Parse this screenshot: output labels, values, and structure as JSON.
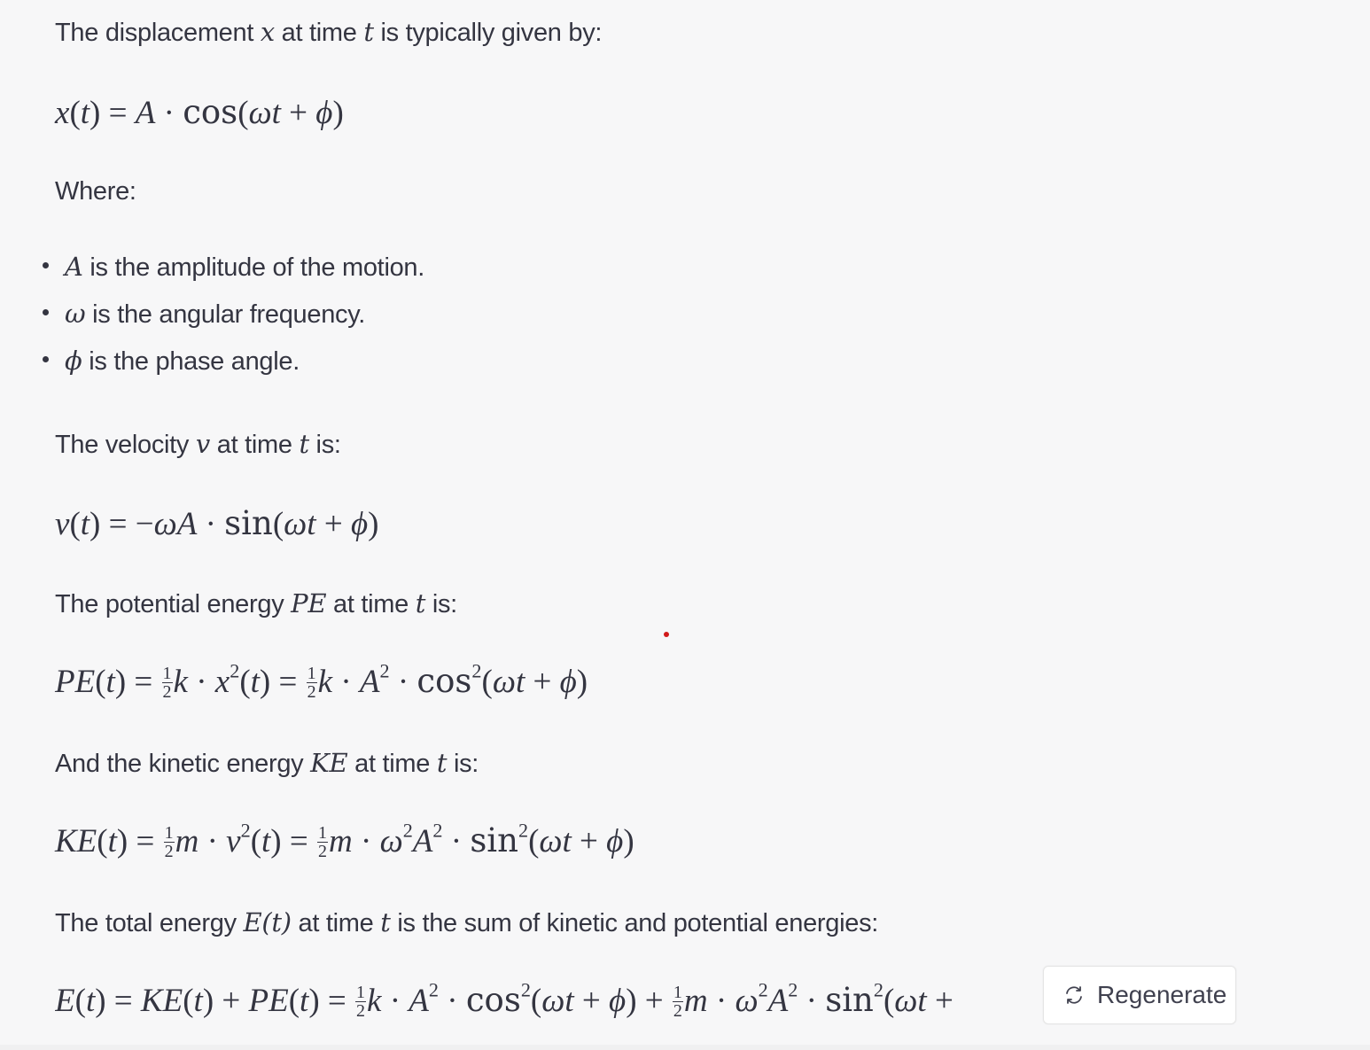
{
  "paragraphs": {
    "p1": {
      "pre": "The displacement ",
      "var1": "x",
      "mid": " at time ",
      "var2": "t",
      "post": " is typically given by:"
    },
    "where": "Where:",
    "p2": {
      "pre": "The velocity ",
      "var1": "v",
      "mid": " at time ",
      "var2": "t",
      "post": " is:"
    },
    "p3": {
      "pre": "The potential energy ",
      "var1": "PE",
      "mid": " at time ",
      "var2": "t",
      "post": " is:"
    },
    "p4": {
      "pre": "And the kinetic energy ",
      "var1": "KE",
      "mid": " at time ",
      "var2": "t",
      "post": " is:"
    },
    "p5": {
      "pre": "The total energy ",
      "var1": "E(t)",
      "mid": " at time ",
      "var2": "t",
      "post": " is the sum of kinetic and potential energies:"
    }
  },
  "bullets": [
    {
      "var": "A",
      "text": " is the amplitude of the motion."
    },
    {
      "var": "ω",
      "text": " is the angular frequency."
    },
    {
      "var": "ϕ",
      "text": " is the phase angle."
    }
  ],
  "equations": {
    "displacement": "x(t) = A · cos(ωt + ϕ)",
    "velocity": "v(t) = −ωA · sin(ωt + ϕ)",
    "potential": "PE(t) = ½k · x²(t) = ½k · A² · cos²(ωt + ϕ)",
    "kinetic": "KE(t) = ½m · v²(t) = ½m · ω²A² · sin²(ωt + ϕ)",
    "total": "E(t) = KE(t) + PE(t) = ½k · A² · cos²(ωt + ϕ) + ½m · ω²A² · sin²(ωt +"
  },
  "regenerate_button": {
    "label": "Regenerate",
    "icon": "refresh-icon"
  },
  "colors": {
    "text": "#343541",
    "background": "#f7f7f8",
    "marker_dot": "#d11a1a"
  }
}
